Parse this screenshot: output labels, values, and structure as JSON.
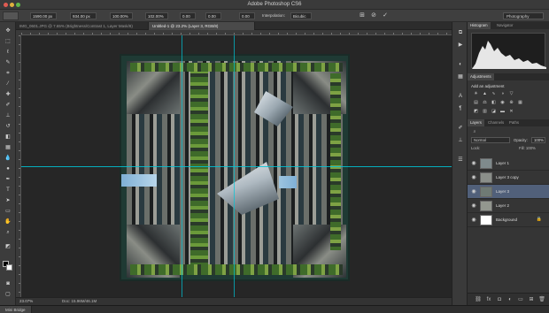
{
  "app": {
    "title": "Adobe Photoshop CS6"
  },
  "options": {
    "fields": [
      "1590.00 px",
      "934.00 px",
      "100.00%",
      "102.00%",
      "0.00",
      "0.00",
      "0.00"
    ],
    "interpolation_label": "Interpolation:",
    "interpolation_value": "Bicubic",
    "workspace": "Photography"
  },
  "tabs": [
    {
      "label": "IMG_0601.JPG @ 7.65% (Brightness/Contrast 1, Layer Mask/8)",
      "active": false
    },
    {
      "label": "Untitled-1 @ 23.2% (Layer 3, RGB/8)",
      "active": true
    }
  ],
  "status": {
    "zoom": "23.07%",
    "doc": "Doc: 15.96M/46.1M"
  },
  "bottom": {
    "mini_bridge": "Mini Bridge"
  },
  "panels": {
    "histogram_tabs": [
      "Histogram",
      "Navigator"
    ],
    "adjustments_tab": "Adjustments",
    "adjustments_title": "Add an adjustment",
    "layers_tabs": [
      "Layers",
      "Channels",
      "Paths"
    ],
    "blend_mode": "Normal",
    "opacity_label": "Opacity:",
    "opacity_value": "100%",
    "lock_label": "Lock:",
    "fill_label": "Fill: 100%"
  },
  "layers": [
    {
      "name": "Layer 1",
      "visible": true,
      "selected": false,
      "thumb_color": "#7f8a8c"
    },
    {
      "name": "Layer 3 copy",
      "visible": true,
      "selected": false,
      "thumb_color": "#8b8f8a"
    },
    {
      "name": "Layer 3",
      "visible": true,
      "selected": true,
      "thumb_color": "#6f7a74"
    },
    {
      "name": "Layer 2",
      "visible": true,
      "selected": false,
      "thumb_color": "#93978f"
    },
    {
      "name": "Background",
      "visible": true,
      "selected": false,
      "thumb_color": "#ffffff",
      "locked": true
    }
  ],
  "colors": {
    "accent_selected": "#51607a",
    "guide": "#00c6d7"
  }
}
